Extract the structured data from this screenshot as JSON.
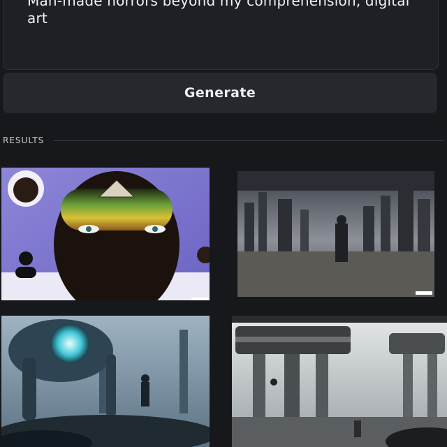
{
  "prompt": {
    "text": "Man-made horrors beyond my comprehension, digital art"
  },
  "actions": {
    "generate_label": "Generate"
  },
  "results": {
    "label": "RESULTS",
    "images": [
      {
        "subject": "surreal portrait with pyramid and eyes"
      },
      {
        "subject": "ruined city with dark figure"
      },
      {
        "subject": "giant robot with glowing eye"
      },
      {
        "subject": "ruined futuristic tower pillars"
      }
    ]
  },
  "colors": {
    "background": "#16181b",
    "panel": "#1d2024",
    "button": "#25282c",
    "text": "#e9eaec"
  }
}
